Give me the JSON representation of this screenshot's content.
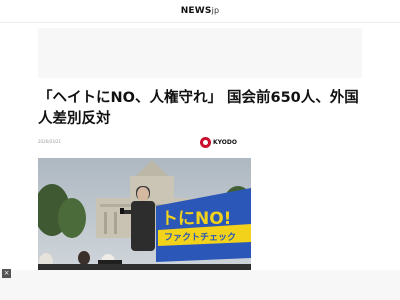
{
  "site": {
    "brand": "NEWS",
    "brand_suffix": "jp"
  },
  "article": {
    "headline": "「ヘイトにNO、人権守れ」 国会前650人、外国人差別反対",
    "date": "2026/03/21",
    "source": "KYODO",
    "photo_banner_text": "トにNO!",
    "photo_banner_subtext": "ファクトチェック"
  },
  "colors": {
    "kyodo_red": "#c8102e",
    "banner_blue": "#2a57b8",
    "banner_yellow": "#f2d21b"
  },
  "icons": {
    "close": "close-icon",
    "logo": "kyodo-logo-icon"
  },
  "controls": {
    "close_label": "×"
  }
}
